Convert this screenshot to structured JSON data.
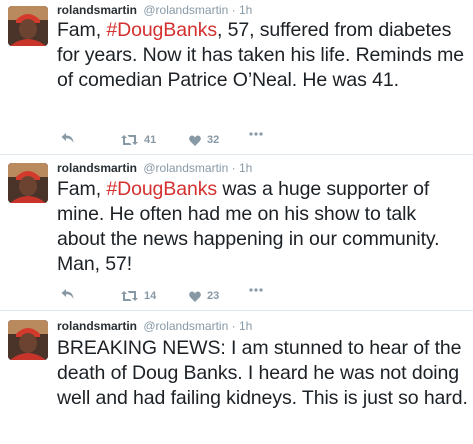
{
  "colors": {
    "hashtag": "#d4302f",
    "muted": "#8899a6",
    "text": "#1c2126"
  },
  "tweets": [
    {
      "name": "rolandsmartin",
      "handle": "@rolandsmartin",
      "separator": "·",
      "time": "1h",
      "text_before": "Fam, ",
      "hashtag": "#DougBanks",
      "text_after": ", 57, suffered from diabetes for years. Now it has taken his life. Reminds me of comedian Patrice O’Neal. He was 41.",
      "retweets": "41",
      "likes": "32",
      "icons": [
        "reply-icon",
        "retweet-icon",
        "heart-icon",
        "more-icon"
      ]
    },
    {
      "name": "rolandsmartin",
      "handle": "@rolandsmartin",
      "separator": "·",
      "time": "1h",
      "text_before": "Fam, ",
      "hashtag": "#DougBanks",
      "text_after": " was a huge supporter of mine. He often had me on his show to talk about the news happening in our community. Man, 57!",
      "retweets": "14",
      "likes": "23",
      "icons": [
        "reply-icon",
        "retweet-icon",
        "heart-icon",
        "more-icon"
      ]
    },
    {
      "name": "rolandsmartin",
      "handle": "@rolandsmartin",
      "separator": "·",
      "time": "1h",
      "text": "BREAKING NEWS: I am stunned to hear of the death of Doug Banks. I heard he was not doing well and had failing kidneys. This is just so hard."
    }
  ]
}
